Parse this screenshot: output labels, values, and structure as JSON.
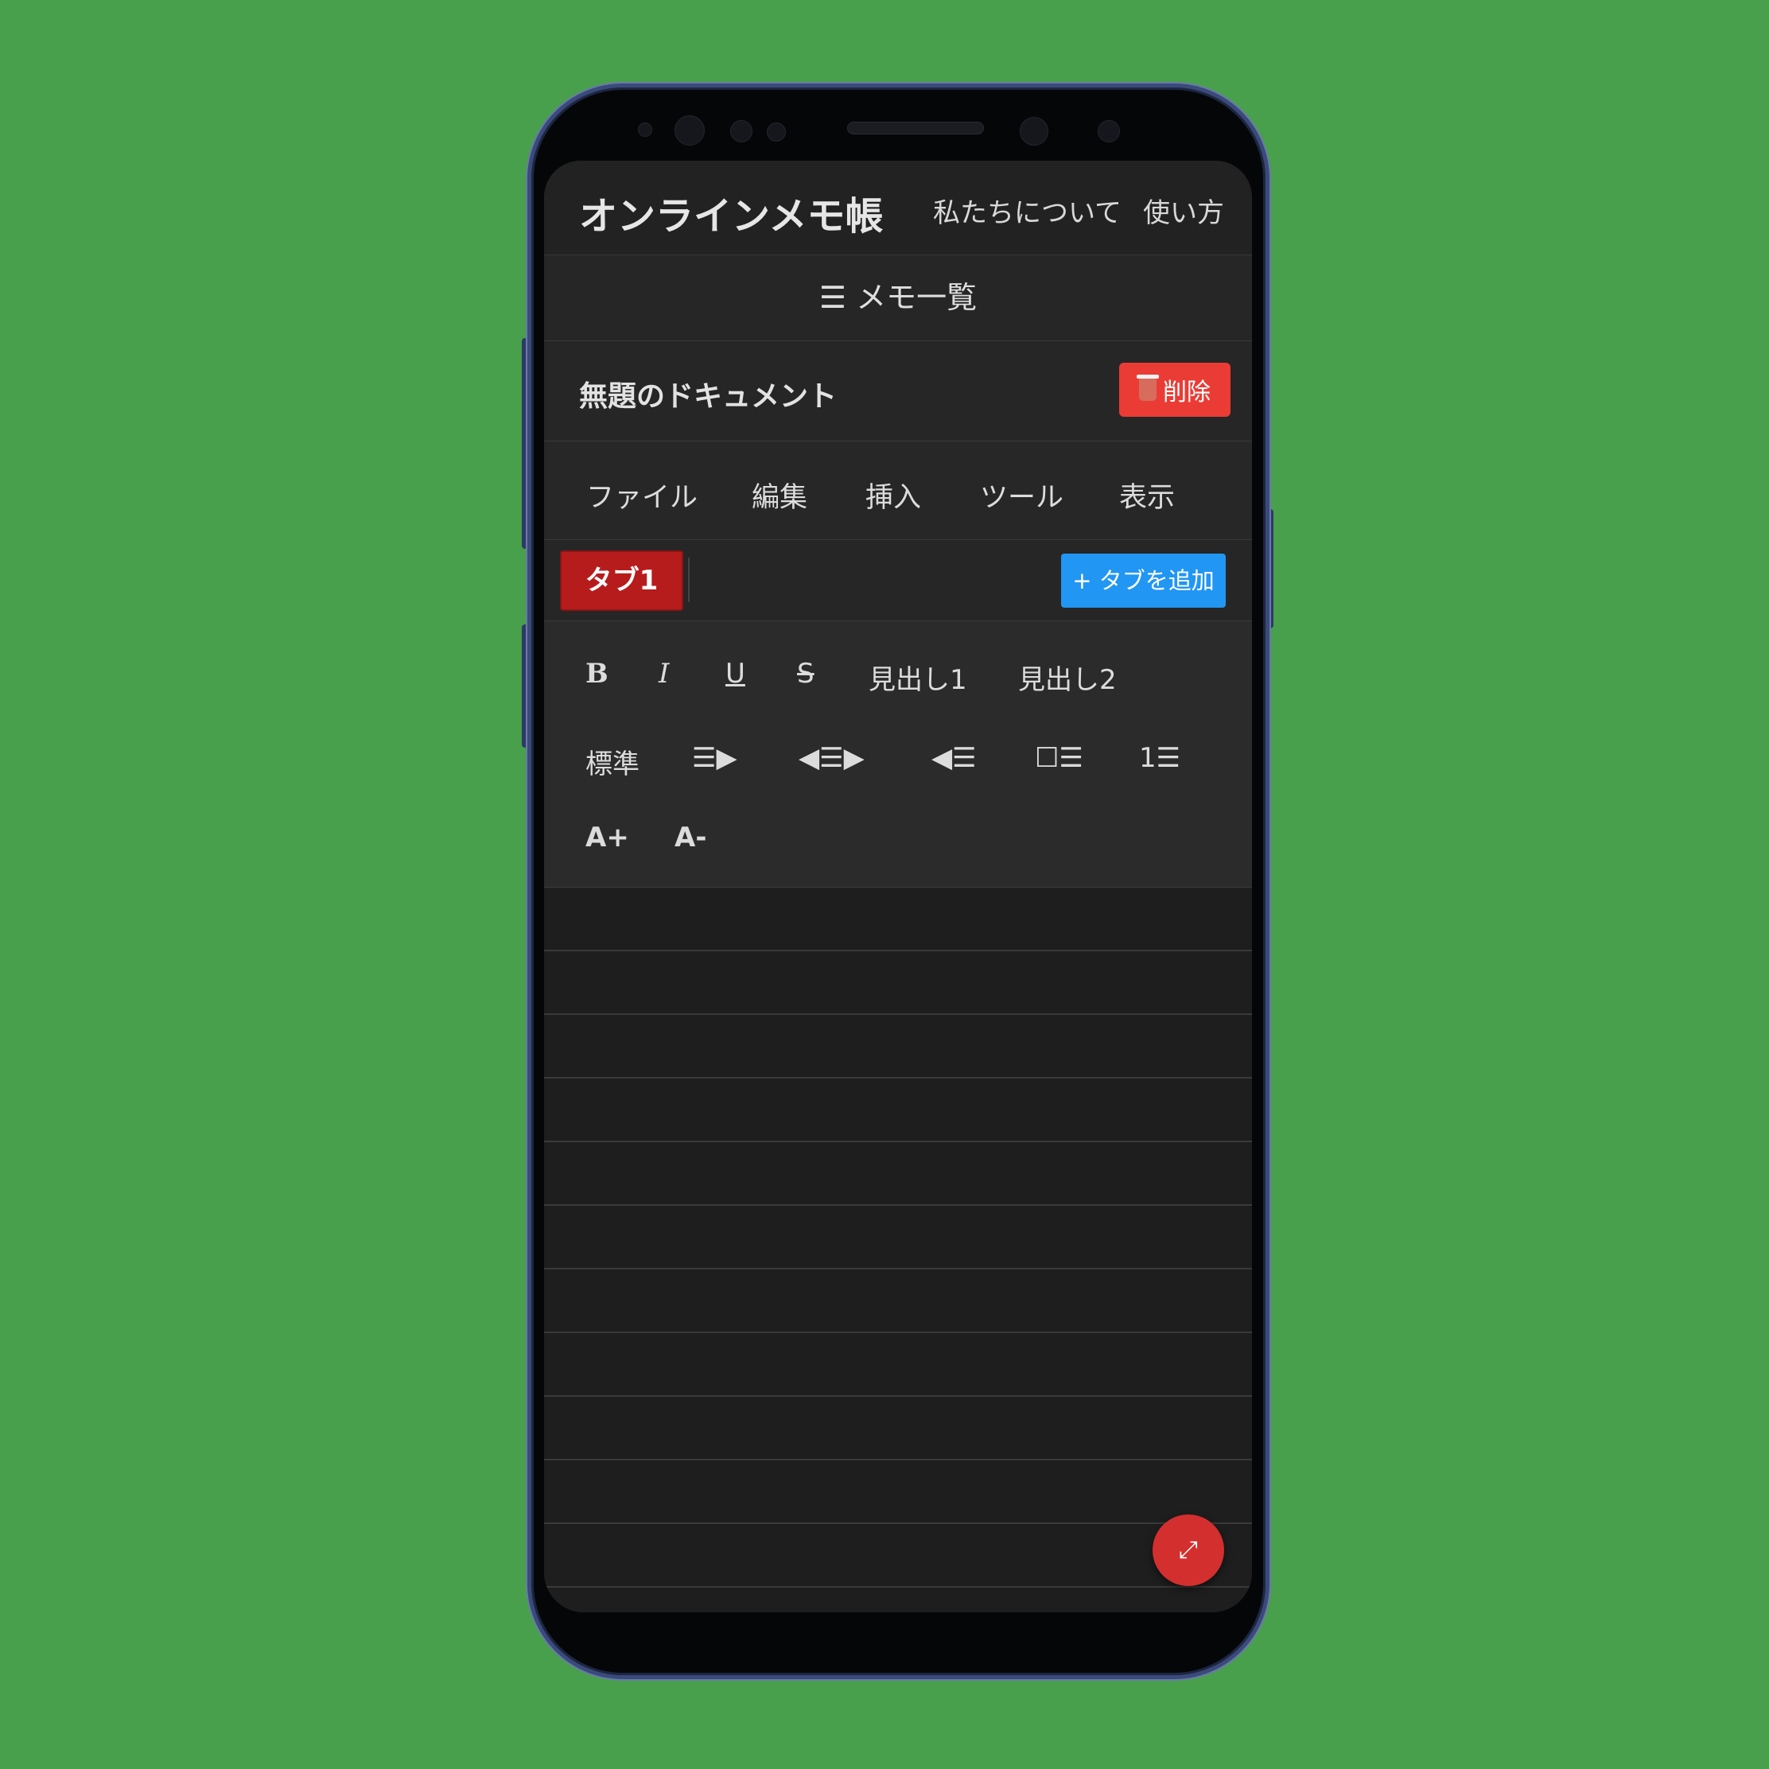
{
  "header": {
    "brand": "オンラインメモ帳",
    "nav": [
      "私たちについて",
      "使い方"
    ]
  },
  "memo_list": {
    "label": "☰ メモ一覧"
  },
  "document": {
    "title": "無題のドキュメント",
    "delete_label": "削除"
  },
  "menu": [
    "ファイル",
    "編集",
    "挿入",
    "ツール",
    "表示"
  ],
  "tabs": {
    "active": "タブ1",
    "add_label": "+ タブを追加"
  },
  "toolbar": {
    "row1": [
      "B",
      "I",
      "U",
      "S",
      "見出し1",
      "見出し2"
    ],
    "row2": [
      "標準",
      "☰▶",
      "◀☰▶",
      "◀☰",
      "☐☰",
      "1☰"
    ],
    "row3": [
      "A+",
      "A-"
    ]
  },
  "fab": {
    "icon": "expand-icon",
    "glyph": "⤢"
  },
  "colors": {
    "background": "#48a04c",
    "delete": "#ea3c35",
    "active_tab": "#b71c1c",
    "add_tab": "#2196f3",
    "fab": "#d32f2f"
  }
}
